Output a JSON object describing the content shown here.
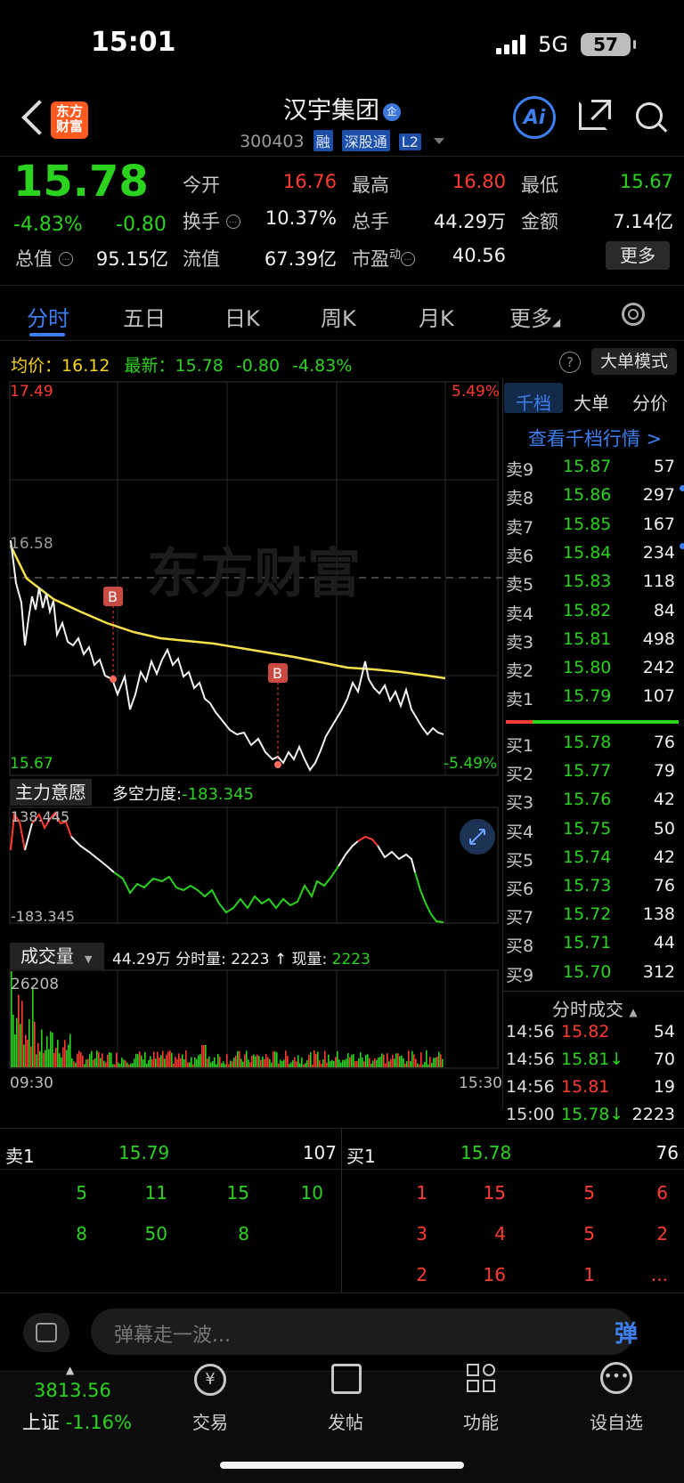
{
  "status": {
    "time": "15:01",
    "network": "5G",
    "battery": "57"
  },
  "header": {
    "logo_line1": "东方",
    "logo_line2": "财富",
    "name": "汉宇集团",
    "name_badge": "企",
    "code": "300403",
    "tags": [
      "融",
      "深股通",
      "L2"
    ],
    "ai_label": "Ai"
  },
  "quote": {
    "price": "15.78",
    "pct": "-4.83%",
    "change": "-0.80",
    "rows": [
      [
        {
          "label": "今开",
          "value": "16.76",
          "color": "red"
        },
        {
          "label": "最高",
          "value": "16.80",
          "color": "red"
        },
        {
          "label": "最低",
          "value": "15.67",
          "color": "green"
        }
      ],
      [
        {
          "label": "换手",
          "value": "10.37%",
          "color": "white"
        },
        {
          "label": "总手",
          "value": "44.29万",
          "color": "white"
        },
        {
          "label": "金额",
          "value": "7.14亿",
          "color": "white"
        }
      ]
    ],
    "row3": {
      "zongzhi_label": "总值",
      "zongzhi": "95.15亿",
      "liuzhi_label": "流值",
      "liuzhi": "67.39亿",
      "pe_label": "市盈",
      "pe_sup": "动",
      "pe": "40.56"
    },
    "more": "更多"
  },
  "tabs": [
    "分时",
    "五日",
    "日K",
    "周K",
    "月K",
    "更多"
  ],
  "info": {
    "avg_label": "均价：",
    "avg": "16.12",
    "latest_label": "最新：",
    "latest": "15.78",
    "chg": "-0.80",
    "pct": "-4.83%",
    "mode_btn": "大单模式",
    "help": "?"
  },
  "price_chart": {
    "y_top": "17.49",
    "y_bot": "15.67",
    "y_mid": "16.58",
    "pct_top": "5.49%",
    "pct_bot": "-5.49%",
    "marker": "B",
    "watermark": "东方财富"
  },
  "intent": {
    "label": "主力意愿",
    "force_label": "多空力度:",
    "force": "-183.345",
    "top": "138.445",
    "bot": "-183.345"
  },
  "volume": {
    "label": "成交量",
    "summary": "44.29万 分时量: 2223 ↑ 现量:",
    "now": "2223",
    "max": "26208",
    "t_start": "09:30",
    "t_end": "15:30"
  },
  "order_tabs": [
    "千档",
    "大单",
    "分价"
  ],
  "order_link": "查看千档行情 >",
  "asks": [
    {
      "label": "卖9",
      "price": "15.87",
      "vol": "57",
      "dot": false
    },
    {
      "label": "卖8",
      "price": "15.86",
      "vol": "297",
      "dot": true
    },
    {
      "label": "卖7",
      "price": "15.85",
      "vol": "167",
      "dot": false
    },
    {
      "label": "卖6",
      "price": "15.84",
      "vol": "234",
      "dot": true
    },
    {
      "label": "卖5",
      "price": "15.83",
      "vol": "118",
      "dot": false
    },
    {
      "label": "卖4",
      "price": "15.82",
      "vol": "84",
      "dot": false
    },
    {
      "label": "卖3",
      "price": "15.81",
      "vol": "498",
      "dot": false
    },
    {
      "label": "卖2",
      "price": "15.80",
      "vol": "242",
      "dot": false
    },
    {
      "label": "卖1",
      "price": "15.79",
      "vol": "107",
      "dot": false
    }
  ],
  "bids": [
    {
      "label": "买1",
      "price": "15.78",
      "vol": "76"
    },
    {
      "label": "买2",
      "price": "15.77",
      "vol": "79"
    },
    {
      "label": "买3",
      "price": "15.76",
      "vol": "42"
    },
    {
      "label": "买4",
      "price": "15.75",
      "vol": "50"
    },
    {
      "label": "买5",
      "price": "15.74",
      "vol": "42"
    },
    {
      "label": "买6",
      "price": "15.73",
      "vol": "76"
    },
    {
      "label": "买7",
      "price": "15.72",
      "vol": "138"
    },
    {
      "label": "买8",
      "price": "15.71",
      "vol": "44"
    },
    {
      "label": "买9",
      "price": "15.70",
      "vol": "312"
    }
  ],
  "trades_title": "分时成交",
  "trades": [
    {
      "t": "14:56",
      "p": "15.82",
      "v": "54",
      "c": "red"
    },
    {
      "t": "14:56",
      "p": "15.81↓",
      "v": "70",
      "c": "green"
    },
    {
      "t": "14:56",
      "p": "15.81",
      "v": "19",
      "c": "red"
    },
    {
      "t": "15:00",
      "p": "15.78↓",
      "v": "2223",
      "c": "green"
    }
  ],
  "detail": {
    "sell_label": "卖1",
    "sell_price": "15.79",
    "sell_vol": "107",
    "buy_label": "买1",
    "buy_price": "15.78",
    "buy_vol": "76",
    "sell_rows": [
      [
        "5",
        "11",
        "15",
        "10"
      ],
      [
        "8",
        "50",
        "8",
        ""
      ]
    ],
    "buy_rows": [
      [
        "1",
        "15",
        "5",
        "6"
      ],
      [
        "3",
        "4",
        "5",
        "2"
      ],
      [
        "2",
        "16",
        "1",
        "..."
      ]
    ]
  },
  "comment": {
    "placeholder": "弹幕走一波...",
    "send": "弹"
  },
  "bottom": {
    "index_value": "3813.56",
    "index_name": "上证",
    "index_pct": "-1.16%",
    "items": [
      "交易",
      "发帖",
      "功能",
      "设自选"
    ]
  }
}
